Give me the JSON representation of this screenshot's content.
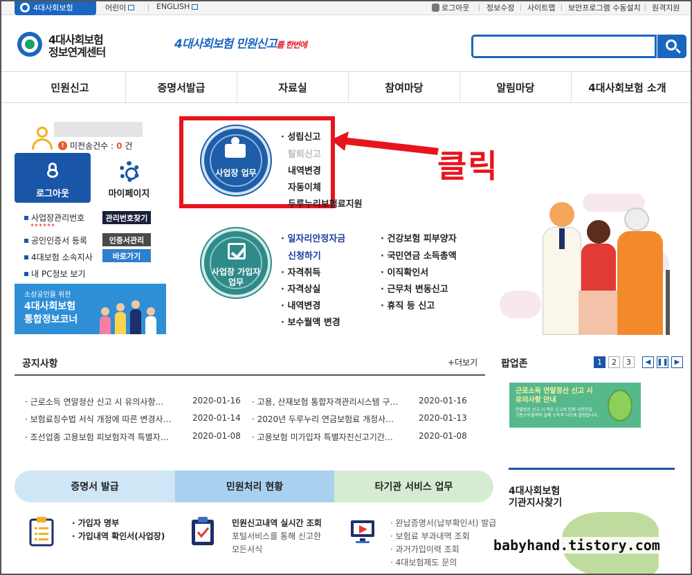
{
  "topbar": {
    "brand_tab": "4대사회보험",
    "kids_link": "어린이",
    "english_link": "ENGLISH",
    "logout": "로그아웃",
    "edit_info": "정보수정",
    "sitemap": "사이트맵",
    "security_install": "보안프로그램 수동설치",
    "remote_support": "원격지원"
  },
  "header": {
    "logo_line1": "4대사회보험",
    "logo_line2": "정보연계센터",
    "slogan_part1": "4대사회보험 ",
    "slogan_part2": "민원신고",
    "slogan_part3": "를 ",
    "slogan_part4": "한번에",
    "search_value": ""
  },
  "nav": [
    "민원신고",
    "증명서발급",
    "자료실",
    "참여마당",
    "알림마당",
    "4대사회보험 소개"
  ],
  "user": {
    "unsent_label": "미전송건수 : ",
    "unsent_count": "0",
    "unsent_unit": "건",
    "logout_tile": "로그아웃",
    "mypage_tile": "마이페이지",
    "masked_id": "******"
  },
  "quick_links": [
    {
      "label": "사업장관리번호",
      "button": "관리번호찾기",
      "button_color": "#1a1f3a"
    },
    {
      "label": "공인인증서 등록",
      "button": "인증서관리",
      "button_color": "#4a4a4a"
    },
    {
      "label": "4대보험 소속지사",
      "button": "바로가기",
      "button_color": "#2f7fd0"
    },
    {
      "label": "내 PC정보 보기",
      "button": "",
      "button_color": ""
    }
  ],
  "banner": {
    "small": "소상공인을 위한",
    "line1": "4대사회보험",
    "line2": "통합정보코너"
  },
  "business": {
    "circle_label": "사업장 업무",
    "items": [
      "성립신고",
      "탈퇴신고",
      "내역변경",
      "자동이체",
      "두루누리보험료지원"
    ]
  },
  "annotation": {
    "click_text": "클릭",
    "highlight_color": "#e8141c"
  },
  "enrollee": {
    "circle_line1": "사업장 가입자",
    "circle_line2": "업무",
    "col1": [
      "일자리안정자금",
      "신청하기",
      "자격취득",
      "자격상실",
      "내역변경",
      "보수월액 변경"
    ],
    "col2": [
      "건강보험 피부양자",
      "국민연금 소득총액",
      "이직확인서",
      "근무처 변동신고",
      "휴직 등 신고"
    ]
  },
  "notices": {
    "title": "공지사항",
    "more": "+더보기",
    "left": [
      {
        "title": "근로소득 연말정산 신고 시 유의사항…",
        "date": "2020-01-16"
      },
      {
        "title": "보험료징수법 서식 개정에 따른 변경사…",
        "date": "2020-01-14"
      },
      {
        "title": "조선업종 고용보험 피보험자격 특별자…",
        "date": "2020-01-08"
      }
    ],
    "right": [
      {
        "title": "고용, 산재보험 통합자격관리시스템 구…",
        "date": "2020-01-16"
      },
      {
        "title": "2020년 두루누리 연금보험료 개정사…",
        "date": "2020-01-13"
      },
      {
        "title": "고용보험 미가입자 특별자진신고기간…",
        "date": "2020-01-08"
      }
    ]
  },
  "popup": {
    "title": "팝업존",
    "pages": [
      "1",
      "2",
      "3"
    ],
    "current_page": "1",
    "banner_line1": "근로소득 연말정산 신고 시",
    "banner_line2": "유의사항 안내",
    "banner_small1": "연말정산 신고 시 작오 신고로 인해 국민연금",
    "banner_small2": "기준소득월액이 실제 소득과 다르게 결정됩니다."
  },
  "services": {
    "tabs": [
      {
        "label": "증명서 발급",
        "color": "#cfe6f7"
      },
      {
        "label": "민원처리 현황",
        "color": "#a9d0ef"
      },
      {
        "label": "타기관 서비스 업무",
        "color": "#d6ecd2"
      }
    ],
    "col1": [
      "가입자 명부",
      "가입내역 확인서(사업장)"
    ],
    "col2_title": "민원신고내역 실시간 조회",
    "col2_line1": "포털서비스를 통해 신고한",
    "col2_line2": "모든서식",
    "col3": [
      "완납증명서(납부확인서) 발급",
      "보험료 부과내역 조회",
      "과거가입이력 조회",
      "4대보험제도 문의"
    ]
  },
  "branch": {
    "line1": "4대사회보험",
    "line2": "기관지사찾기"
  },
  "watermark": "babyhand.tistory.com"
}
